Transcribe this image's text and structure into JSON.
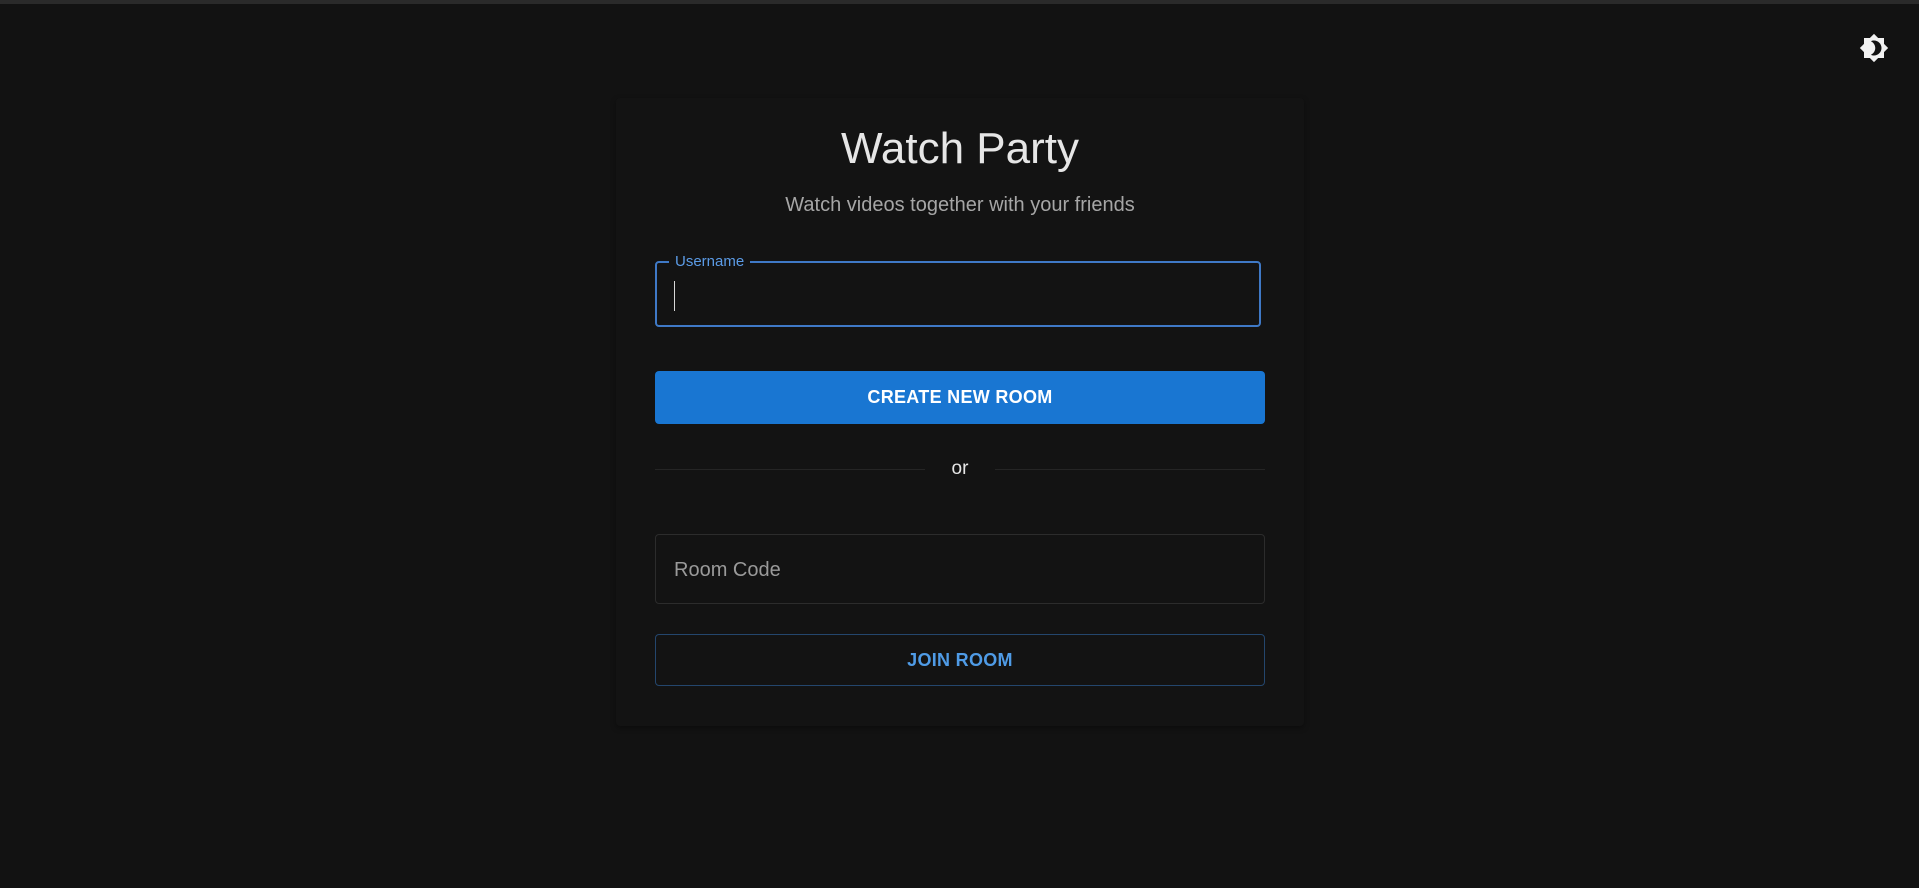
{
  "header": {
    "theme_toggle_icon": "brightness-icon"
  },
  "card": {
    "title": "Watch Party",
    "subtitle": "Watch videos together with your friends",
    "username": {
      "label": "Username",
      "value": ""
    },
    "create_button_label": "CREATE NEW ROOM",
    "divider_text": "or",
    "room_code": {
      "placeholder": "Room Code",
      "value": ""
    },
    "join_button_label": "JOIN ROOM"
  },
  "colors": {
    "background": "#121212",
    "card_background": "#131313",
    "primary": "#1976d2",
    "focus_outline": "#3f79c6",
    "outline_button_text": "#4f9be6",
    "text_primary": "#e6e6e6",
    "text_secondary": "#a6a6a6"
  }
}
